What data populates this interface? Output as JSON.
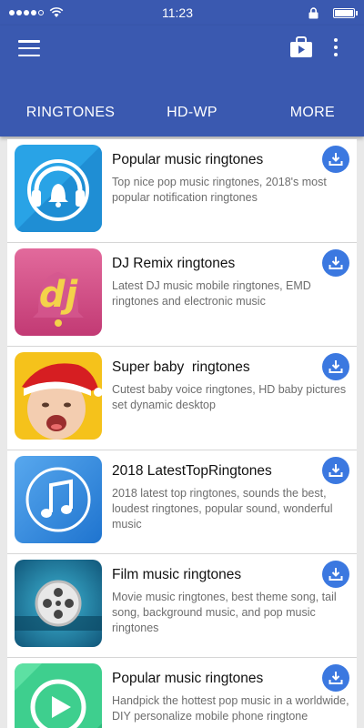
{
  "status_bar": {
    "time": "11:23"
  },
  "app_bar": {
    "icons": [
      "menu-icon",
      "shop-bag-icon",
      "more-vert-icon"
    ]
  },
  "tabs": [
    {
      "label": "RINGTONES"
    },
    {
      "label": "HD-WP"
    },
    {
      "label": "MORE"
    }
  ],
  "colors": {
    "primary": "#3a59b0",
    "download": "#3b78e0",
    "title": "#111111",
    "description": "#6d6d6d"
  },
  "items": [
    {
      "title": "Popular music ringtones",
      "description": "Top nice pop music ringtones, 2018's most popular notification ringtones",
      "icon": "headphones-bell-icon"
    },
    {
      "title": "DJ Remix ringtones",
      "description": "Latest DJ music mobile ringtones, EMD ringtones and electronic music",
      "icon": "dj-bell-icon"
    },
    {
      "title": "Super baby  ringtones",
      "description": "Cutest baby voice ringtones, HD baby pictures set dynamic desktop",
      "icon": "baby-santa-hat-photo"
    },
    {
      "title": "2018 LatestTopRingtones",
      "description": "2018 latest top ringtones, sounds the best, loudest ringtones, popular sound, wonderful music",
      "icon": "music-note-icon"
    },
    {
      "title": "Film music ringtones",
      "description": "Movie music ringtones, best theme song, tail song, background music, and pop music ringtones",
      "icon": "film-reel-icon"
    },
    {
      "title": "Popular music ringtones",
      "description": "Handpick the hottest pop music in a worldwide, DIY personalize mobile phone ringtone",
      "icon": "play-button-icon"
    }
  ]
}
